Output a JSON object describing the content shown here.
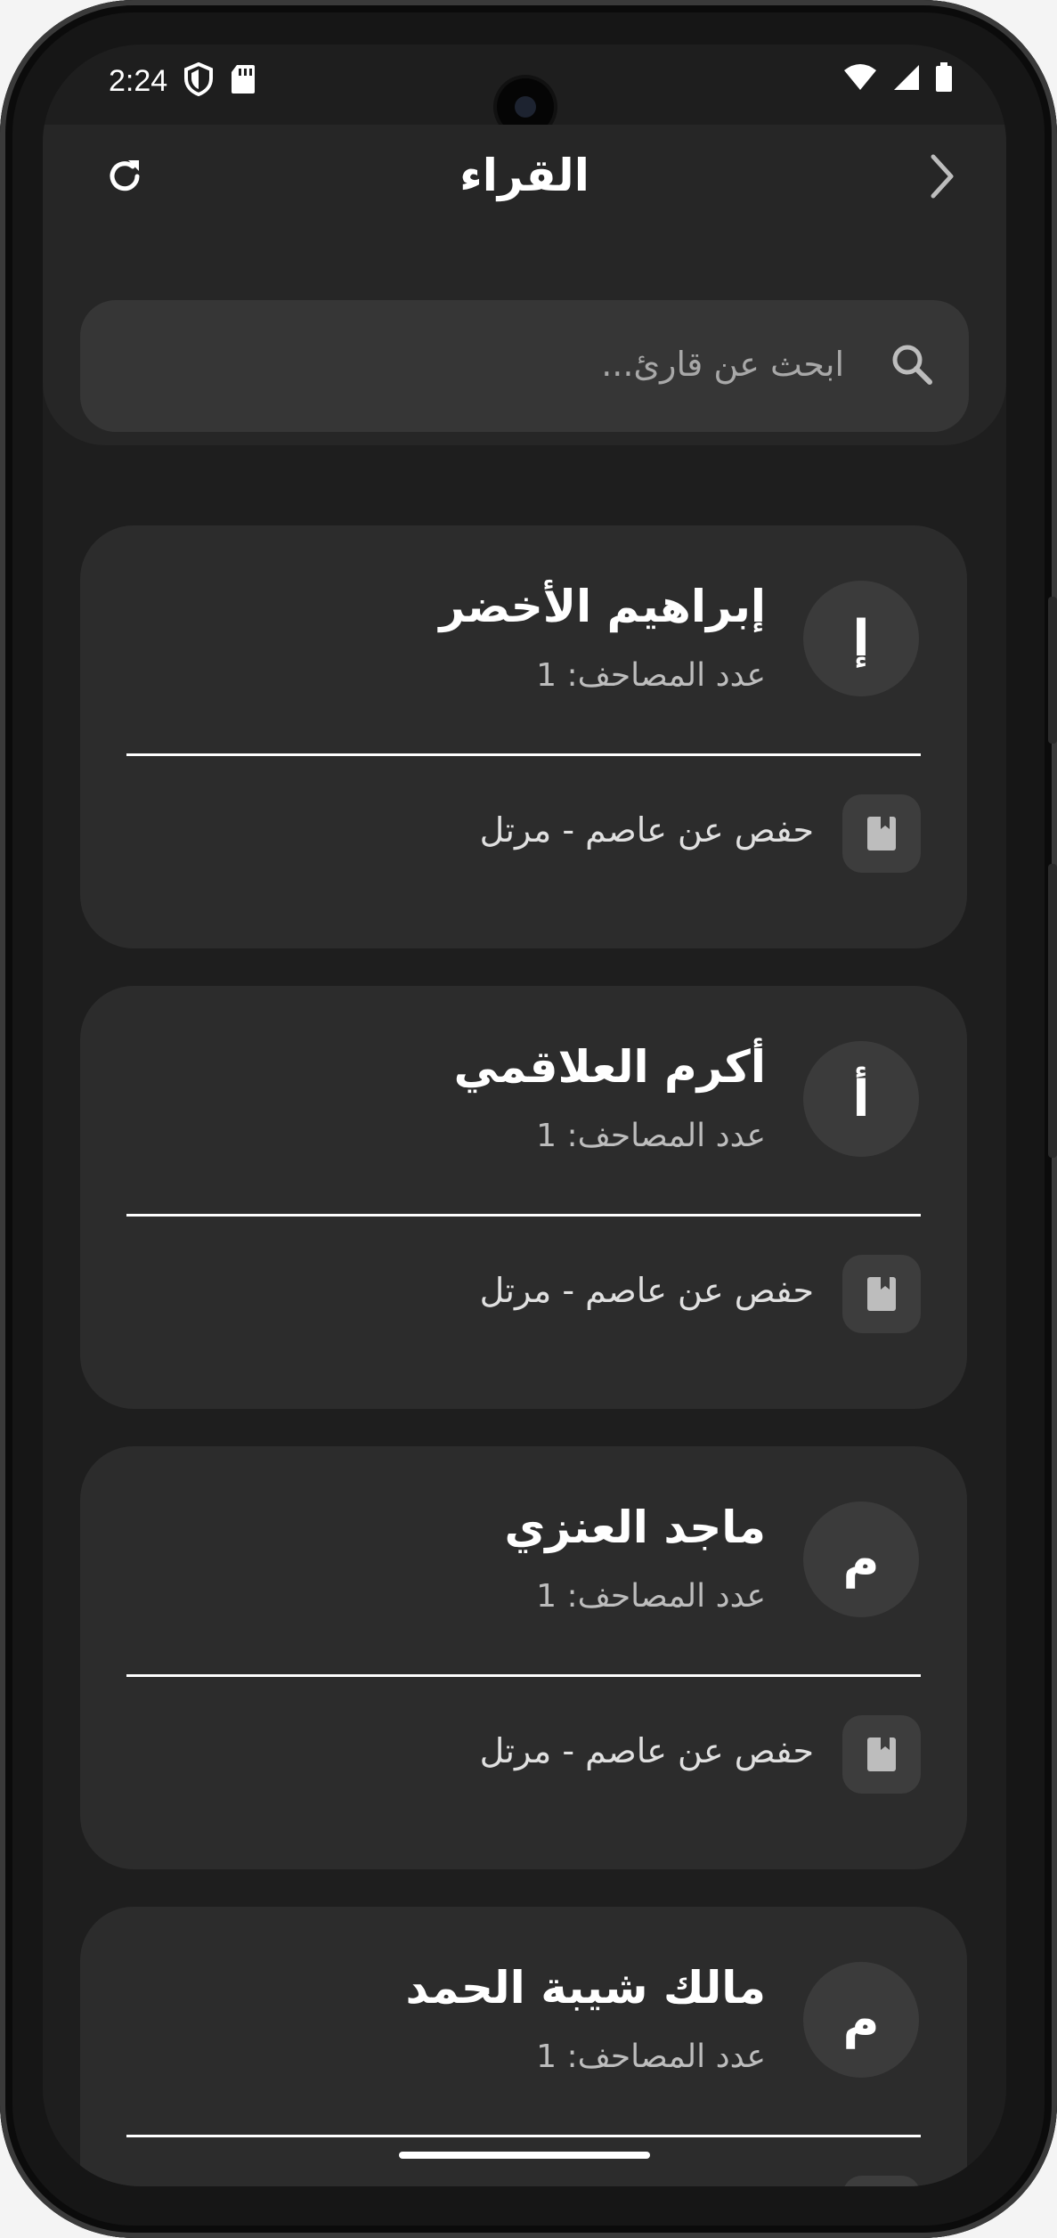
{
  "status_bar": {
    "time": "2:24",
    "icons": [
      "shield-icon",
      "sd-card-icon",
      "wifi-icon",
      "signal-icon",
      "battery-icon"
    ]
  },
  "app_bar": {
    "title": "القراء",
    "refresh_icon": "refresh-icon",
    "back_icon": "chevron-right-icon"
  },
  "search": {
    "placeholder": "ابحث عن قارئ..."
  },
  "readers": [
    {
      "initial": "إ",
      "name": "إبراهيم الأخضر",
      "count_label": "عدد المصاحف: 1",
      "mushafs": [
        "حفص عن عاصم - مرتل"
      ]
    },
    {
      "initial": "أ",
      "name": "أكرم العلاقمي",
      "count_label": "عدد المصاحف: 1",
      "mushafs": [
        "حفص عن عاصم - مرتل"
      ]
    },
    {
      "initial": "م",
      "name": "ماجد العنزي",
      "count_label": "عدد المصاحف: 1",
      "mushafs": [
        "حفص عن عاصم - مرتل"
      ]
    },
    {
      "initial": "م",
      "name": "مالك شيبة الحمد",
      "count_label": "عدد المصاحف: 1",
      "mushafs": []
    }
  ],
  "colors": {
    "background": "#1e1e1e",
    "surface": "#2c2c2c",
    "app_bar": "#262626",
    "search_field": "#363636",
    "text_primary": "#ffffff",
    "text_secondary": "#bdbdbd"
  }
}
